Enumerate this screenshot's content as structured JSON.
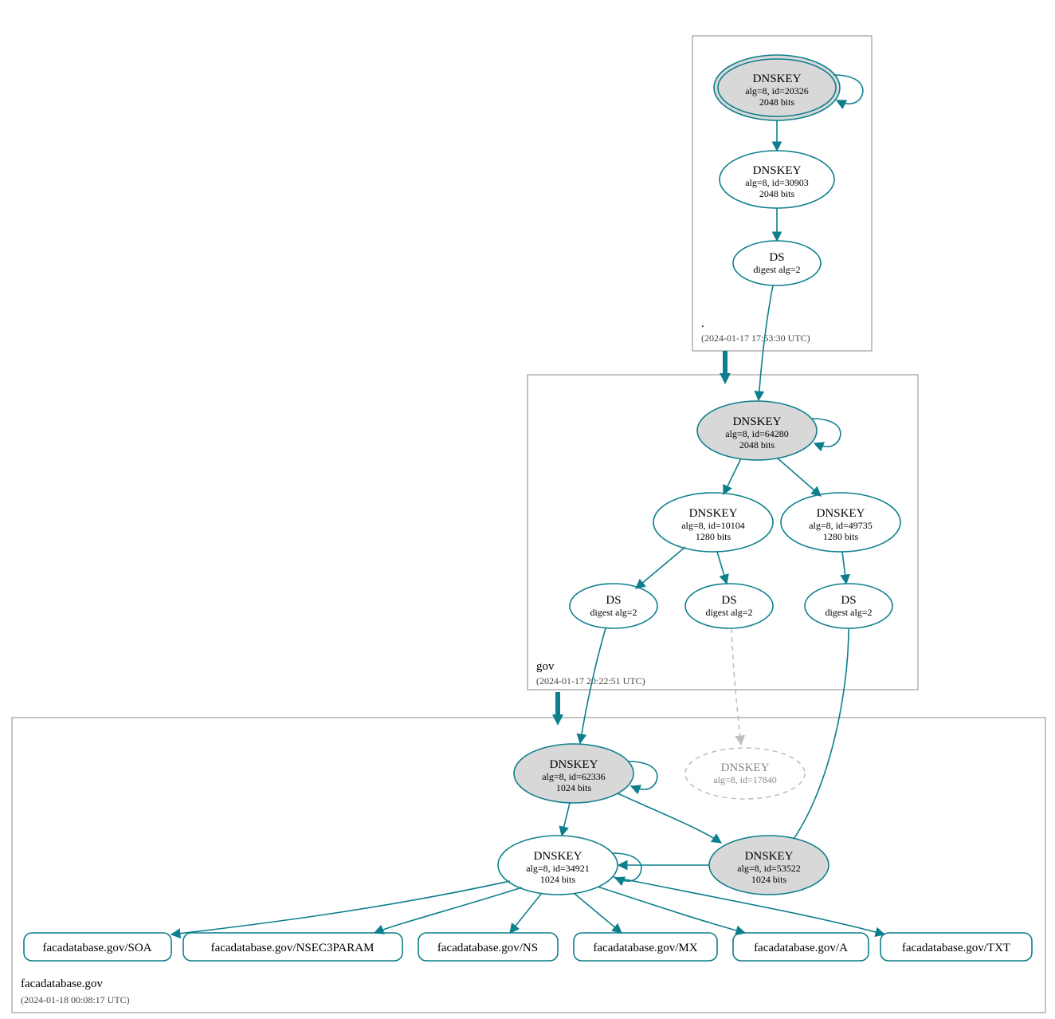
{
  "colors": {
    "stroke": "#0d7f8c",
    "ghost": "#bfbfbf",
    "fillGrey": "#d8d8d8"
  },
  "zones": {
    "root": {
      "title": ".",
      "time": "(2024-01-17 17:53:30 UTC)"
    },
    "gov": {
      "title": "gov",
      "time": "(2024-01-17 20:22:51 UTC)"
    },
    "domain": {
      "title": "facadatabase.gov",
      "time": "(2024-01-18 00:08:17 UTC)"
    }
  },
  "nodes": {
    "root_ksk": {
      "l1": "DNSKEY",
      "l2": "alg=8, id=20326",
      "l3": "2048 bits"
    },
    "root_zsk": {
      "l1": "DNSKEY",
      "l2": "alg=8, id=30903",
      "l3": "2048 bits"
    },
    "root_ds": {
      "l1": "DS",
      "l2": "digest alg=2"
    },
    "gov_ksk": {
      "l1": "DNSKEY",
      "l2": "alg=8, id=64280",
      "l3": "2048 bits"
    },
    "gov_zsk": {
      "l1": "DNSKEY",
      "l2": "alg=8, id=10104",
      "l3": "1280 bits"
    },
    "gov_k2": {
      "l1": "DNSKEY",
      "l2": "alg=8, id=49735",
      "l3": "1280 bits"
    },
    "gov_ds1": {
      "l1": "DS",
      "l2": "digest alg=2"
    },
    "gov_ds2": {
      "l1": "DS",
      "l2": "digest alg=2"
    },
    "gov_ds3": {
      "l1": "DS",
      "l2": "digest alg=2"
    },
    "dom_ksk": {
      "l1": "DNSKEY",
      "l2": "alg=8, id=62336",
      "l3": "1024 bits"
    },
    "dom_ghost": {
      "l1": "DNSKEY",
      "l2": "alg=8, id=17840"
    },
    "dom_zsk": {
      "l1": "DNSKEY",
      "l2": "alg=8, id=34921",
      "l3": "1024 bits"
    },
    "dom_k2": {
      "l1": "DNSKEY",
      "l2": "alg=8, id=53522",
      "l3": "1024 bits"
    }
  },
  "rr": {
    "soa": "facadatabase.gov/SOA",
    "nsec3param": "facadatabase.gov/NSEC3PARAM",
    "ns": "facadatabase.gov/NS",
    "mx": "facadatabase.gov/MX",
    "a": "facadatabase.gov/A",
    "txt": "facadatabase.gov/TXT"
  }
}
